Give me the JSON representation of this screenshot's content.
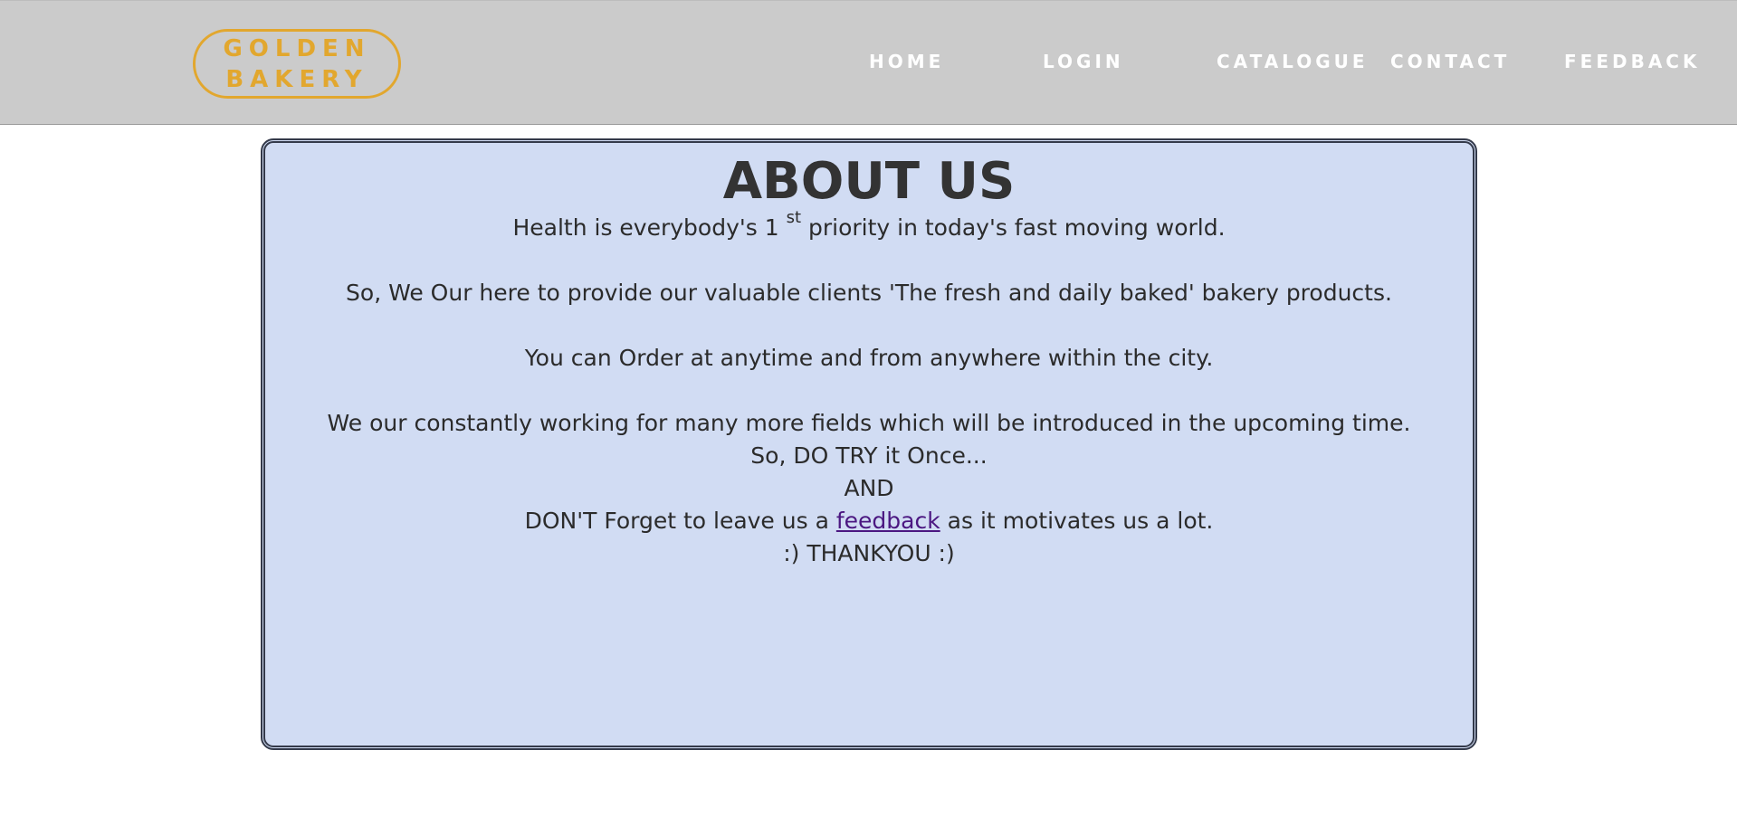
{
  "logo": {
    "line1": "GOLDEN",
    "line2": "BAKERY"
  },
  "nav": {
    "home": "HOME",
    "login": "LOGIN",
    "catalogue": "CATALOGUE",
    "contact": "CONTACT",
    "feedback": "FEEDBACK"
  },
  "about": {
    "title": "ABOUT US",
    "line1_before": "Health is everybody's 1 ",
    "line1_sup": "st",
    "line1_after": " priority in today's fast moving world.",
    "line2": "So, We Our here to provide our valuable clients 'The fresh and daily baked' bakery products.",
    "line3": "You can Order at anytime and from anywhere within the city.",
    "line4": "We our constantly working for many more fields which will be introduced in the upcoming time.",
    "line5": "So, DO TRY it Once...",
    "line6": "AND",
    "line7_before": "DON'T Forget to leave us a ",
    "line7_link": "feedback",
    "line7_after": " as it motivates us a lot.",
    "line8": ":) THANKYOU :)"
  },
  "colors": {
    "navbar_bg": "#cbcbcb",
    "logo_gold": "#e2a72e",
    "box_bg": "#d1dcf3",
    "link_purple": "#4b1781"
  }
}
